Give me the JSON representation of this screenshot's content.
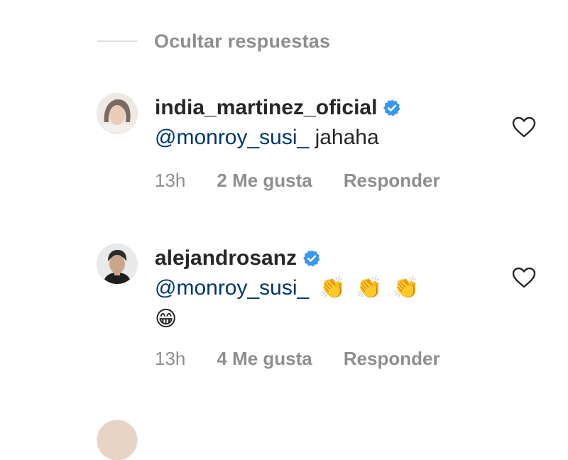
{
  "hide_replies": {
    "label": "Ocultar respuestas"
  },
  "comments": [
    {
      "username": "india_martinez_oficial",
      "verified": true,
      "mention": "@monroy_susi_",
      "text": "jahaha",
      "time": "13h",
      "likes": "2 Me gusta",
      "reply": "Responder",
      "avatar_icon": "woman-portrait-avatar",
      "like_icon": "heart-outline-icon"
    },
    {
      "username": "alejandrosanz",
      "verified": true,
      "mention": "@monroy_susi_",
      "emojis_line1": [
        "👏",
        "👏",
        "👏"
      ],
      "emojis_line2": [
        "😁"
      ],
      "time": "13h",
      "likes": "4 Me gusta",
      "reply": "Responder",
      "avatar_icon": "man-portrait-avatar",
      "like_icon": "heart-outline-icon"
    }
  ],
  "colors": {
    "text": "#262626",
    "muted": "#8e8e8e",
    "mention": "#00376b",
    "verified": "#3897f0"
  }
}
